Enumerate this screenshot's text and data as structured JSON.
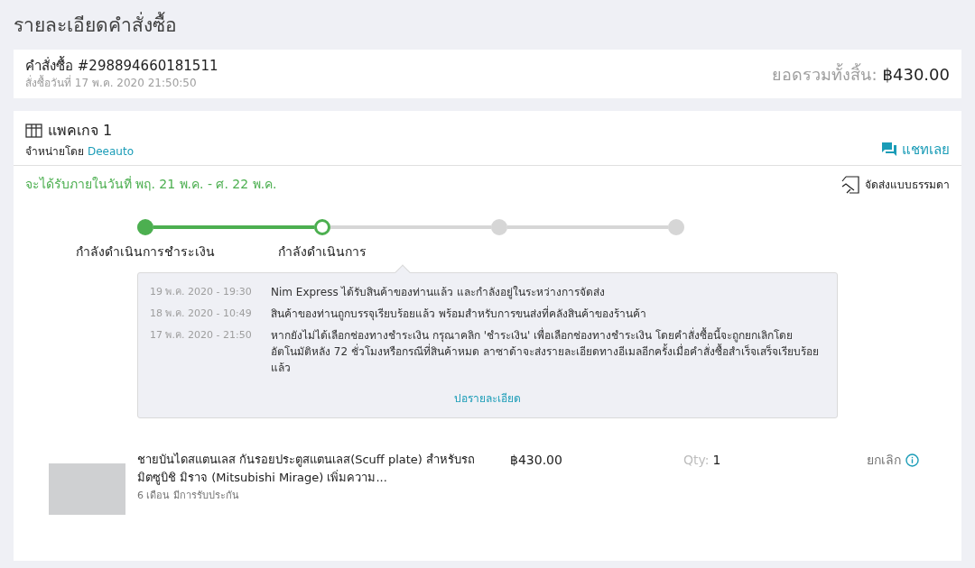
{
  "page_title": "รายละเอียดคำสั่งซื้อ",
  "order": {
    "number": "คำสั่งซื้อ #298894660181511",
    "date": "สั่งซื้อวันที่ 17 พ.ค. 2020 21:50:50",
    "total_label": "ยอดรวมทั้งสิ้น:",
    "total_value": "฿430.00"
  },
  "package": {
    "title": "แพคเกจ 1",
    "sold_by_label": "จำหน่ายโดย",
    "seller": "Deeauto",
    "chat": "แชทเลย",
    "delivery_estimate": "จะได้รับภายในวันที่ พฤ. 21 พ.ค. - ศ. 22 พ.ค.",
    "shipping_method": "จัดส่งแบบธรรมดา",
    "steps": [
      {
        "label": "กำลังดำเนินการชำระเงิน",
        "done": true,
        "current": false
      },
      {
        "label": "กำลังดำเนินการ",
        "done": false,
        "current": true
      },
      {
        "done": false,
        "current": false
      },
      {
        "done": false,
        "current": false
      }
    ],
    "timeline": [
      {
        "time": "19 พ.ค. 2020 - 19:30",
        "text": "Nim Express ได้รับสินค้าของท่านแล้ว และกำลังอยู่ในระหว่างการจัดส่ง"
      },
      {
        "time": "18 พ.ค. 2020 - 10:49",
        "text": "สินค้าของท่านถูกบรรจุเรียบร้อยแล้ว พร้อมสำหรับการขนส่งที่คลังสินค้าของร้านค้า"
      },
      {
        "time": "17 พ.ค. 2020 - 21:50",
        "text": "หากยังไม่ได้เลือกช่องทางชำระเงิน กรุณาคลิก 'ชำระเงิน' เพื่อเลือกช่องทางชำระเงิน โดยคำสั่งซื้อนี้จะถูกยกเลิกโดยอัตโนมัติหลัง 72 ชั่วโมงหรือกรณีที่สินค้าหมด ลาซาด้าจะส่งรายละเอียดทางอีเมลอีกครั้งเมื่อคำสั่งซื้อสำเร็จเสร็จเรียบร้อยแล้ว"
      }
    ],
    "timeline_toggle": "ปอรายละเอียด",
    "items": [
      {
        "title": "ชายบันไดสแตนเลส กันรอยประตูสแตนเลส(Scuff plate) สำหรับรถมิตซูบิชิ มิราจ (Mitsubishi Mirage) เพิ่มความ...",
        "warranty": "6 เดือน มีการรับประกัน",
        "price": "฿430.00",
        "qty_label": "Qty:",
        "qty": "1",
        "cancel": "ยกเลิก"
      }
    ]
  }
}
